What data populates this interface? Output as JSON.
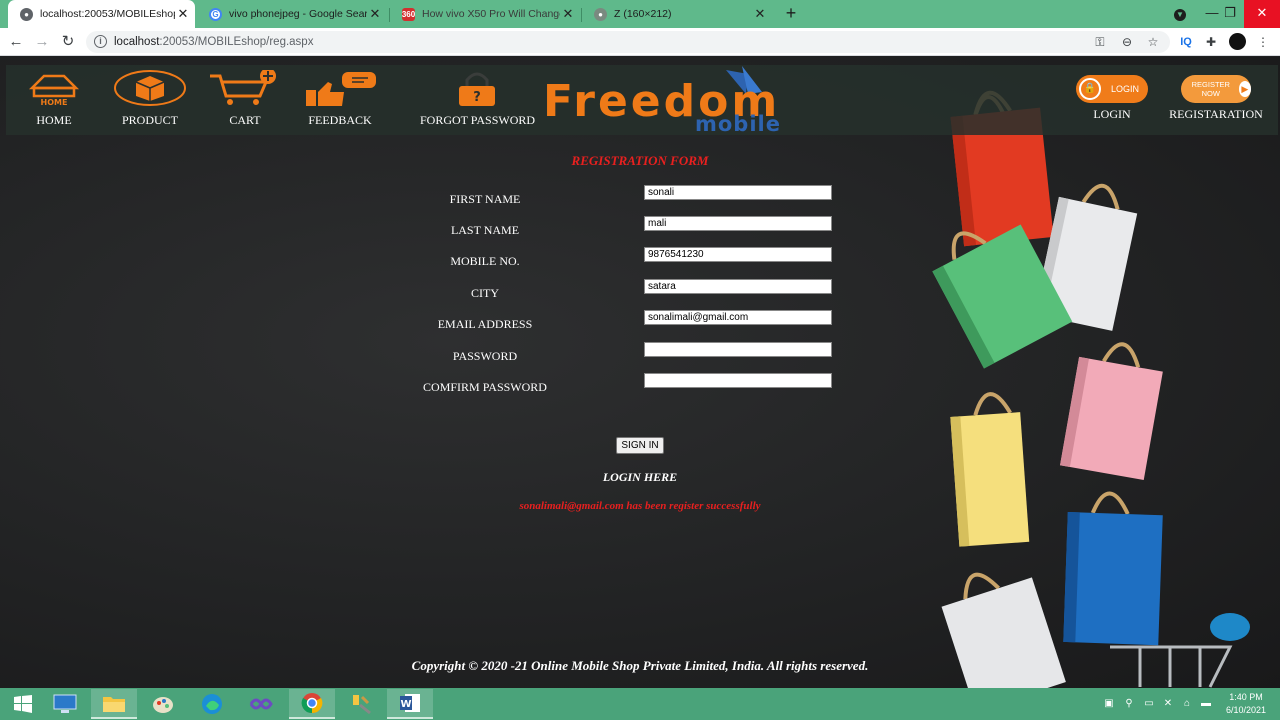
{
  "browser": {
    "tabs": [
      {
        "title": "localhost:20053/MOBILEshop/reg",
        "active": true
      },
      {
        "title": "vivo phonejpeg - Google Search",
        "active": false
      },
      {
        "title": "How vivo X50 Pro Will Change th",
        "active": false
      },
      {
        "title": "Z (160×212)",
        "active": false
      }
    ],
    "url_host": "localhost",
    "url_rest": ":20053/MOBILEshop/reg.aspx",
    "extension_label": "IQ"
  },
  "nav": {
    "home": "HOME",
    "home_icon_text": "HOME",
    "product": "PRODUCT",
    "cart": "CART",
    "feedback": "FEEDBACK",
    "forgot": "FORGOT PASSWORD",
    "login": "LOGIN",
    "login_btn": "LOGIN",
    "register": "REGISTARATION",
    "register_btn": "REGISTER NOW"
  },
  "brand": {
    "name": "Freedom",
    "sub": "mobile"
  },
  "form": {
    "title": "REGISTRATION FORM",
    "fields": [
      {
        "label": "FIRST NAME",
        "value": "sonali"
      },
      {
        "label": "LAST NAME",
        "value": "mali"
      },
      {
        "label": "MOBILE NO.",
        "value": "9876541230"
      },
      {
        "label": "CITY",
        "value": "satara"
      },
      {
        "label": "EMAIL ADDRESS",
        "value": "sonalimali@gmail.com"
      },
      {
        "label": "PASSWORD",
        "value": ""
      },
      {
        "label": "COMFIRM PASSWORD",
        "value": ""
      }
    ],
    "submit": "SIGN IN",
    "login_link": "LOGIN HERE",
    "message": "sonalimali@gmail.com has been register successfully"
  },
  "footer": {
    "copyright": "Copyright © 2020 -21 Online Mobile Shop Private Limited, India. All rights reserved."
  },
  "taskbar": {
    "time": "1:40 PM",
    "date": "6/10/2021"
  },
  "colors": {
    "accent": "#ef7a18",
    "error": "#e8201f",
    "brand_blue": "#2d63b0",
    "taskbar": "#4aa37a"
  }
}
